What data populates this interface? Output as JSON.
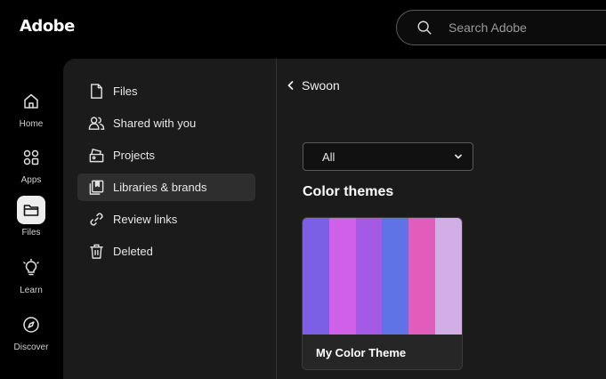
{
  "header": {
    "logo_text": "Adobe",
    "search_placeholder": "Search Adobe"
  },
  "rail": {
    "items": [
      {
        "label": "Home",
        "icon": "home-icon",
        "active": false
      },
      {
        "label": "Apps",
        "icon": "apps-icon",
        "active": false
      },
      {
        "label": "Files",
        "icon": "folder-icon",
        "active": true
      },
      {
        "label": "Learn",
        "icon": "lightbulb-icon",
        "active": false
      },
      {
        "label": "Discover",
        "icon": "compass-icon",
        "active": false
      }
    ]
  },
  "nav": {
    "items": [
      {
        "label": "Files",
        "icon": "file-icon",
        "active": false
      },
      {
        "label": "Shared with you",
        "icon": "people-icon",
        "active": false
      },
      {
        "label": "Projects",
        "icon": "projects-icon",
        "active": false
      },
      {
        "label": "Libraries & brands",
        "icon": "libraries-icon",
        "active": true
      },
      {
        "label": "Review links",
        "icon": "link-icon",
        "active": false
      },
      {
        "label": "Deleted",
        "icon": "trash-icon",
        "active": false
      }
    ]
  },
  "main": {
    "back_label": "Swoon",
    "filter_value": "All",
    "section_title": "Color themes",
    "theme_card": {
      "title": "My Color Theme",
      "colors": [
        "#7b5fe4",
        "#d160e8",
        "#a45ae4",
        "#5f73e6",
        "#e25cbb",
        "#d1aee6"
      ]
    }
  },
  "colors": {
    "background": "#000000",
    "panel": "#1b1b1b",
    "active_nav": "#2e2e2e",
    "active_rail": "#ededed"
  }
}
